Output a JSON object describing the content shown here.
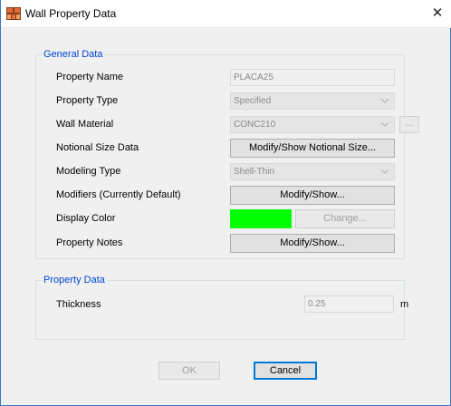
{
  "window": {
    "title": "Wall Property Data",
    "close_glyph": "✕"
  },
  "general": {
    "legend": "General Data",
    "property_name": {
      "label": "Property Name",
      "value": "PLACA25"
    },
    "property_type": {
      "label": "Property Type",
      "value": "Specified"
    },
    "wall_material": {
      "label": "Wall Material",
      "value": "CONC210",
      "browse_label": "..."
    },
    "notional_size": {
      "label": "Notional Size Data",
      "button": "Modify/Show Notional Size..."
    },
    "modeling_type": {
      "label": "Modeling Type",
      "value": "Shell-Thin"
    },
    "modifiers": {
      "label": "Modifiers (Currently Default)",
      "button": "Modify/Show..."
    },
    "display_color": {
      "label": "Display Color",
      "color": "#00ff00",
      "button": "Change..."
    },
    "property_notes": {
      "label": "Property Notes",
      "button": "Modify/Show..."
    }
  },
  "property": {
    "legend": "Property Data",
    "thickness": {
      "label": "Thickness",
      "value": "0.25",
      "unit": "m"
    }
  },
  "footer": {
    "ok": "OK",
    "cancel": "Cancel"
  },
  "colors": {
    "legend": "#0046d5",
    "accent": "#0078d7"
  }
}
